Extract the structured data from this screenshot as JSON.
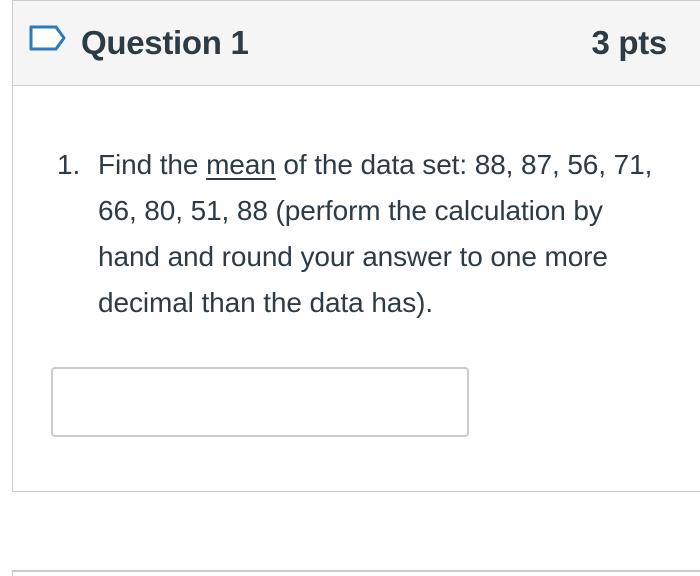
{
  "question": {
    "title": "Question 1",
    "points": "3 pts",
    "flag_icon": "flag-outline-icon",
    "number": "1.",
    "text_before": "Find the ",
    "emphasized_word": "mean",
    "text_after": " of the data set: 88, 87, 56, 71, 66, 80, 51, 88 (perform the calculation by hand and round your answer to one more decimal than the data has).",
    "answer_value": "",
    "answer_placeholder": ""
  },
  "colors": {
    "header_background": "#f5f5f5",
    "border": "#c7cdd1",
    "text": "#2d3b45",
    "flag_accent": "#2b7abc"
  }
}
